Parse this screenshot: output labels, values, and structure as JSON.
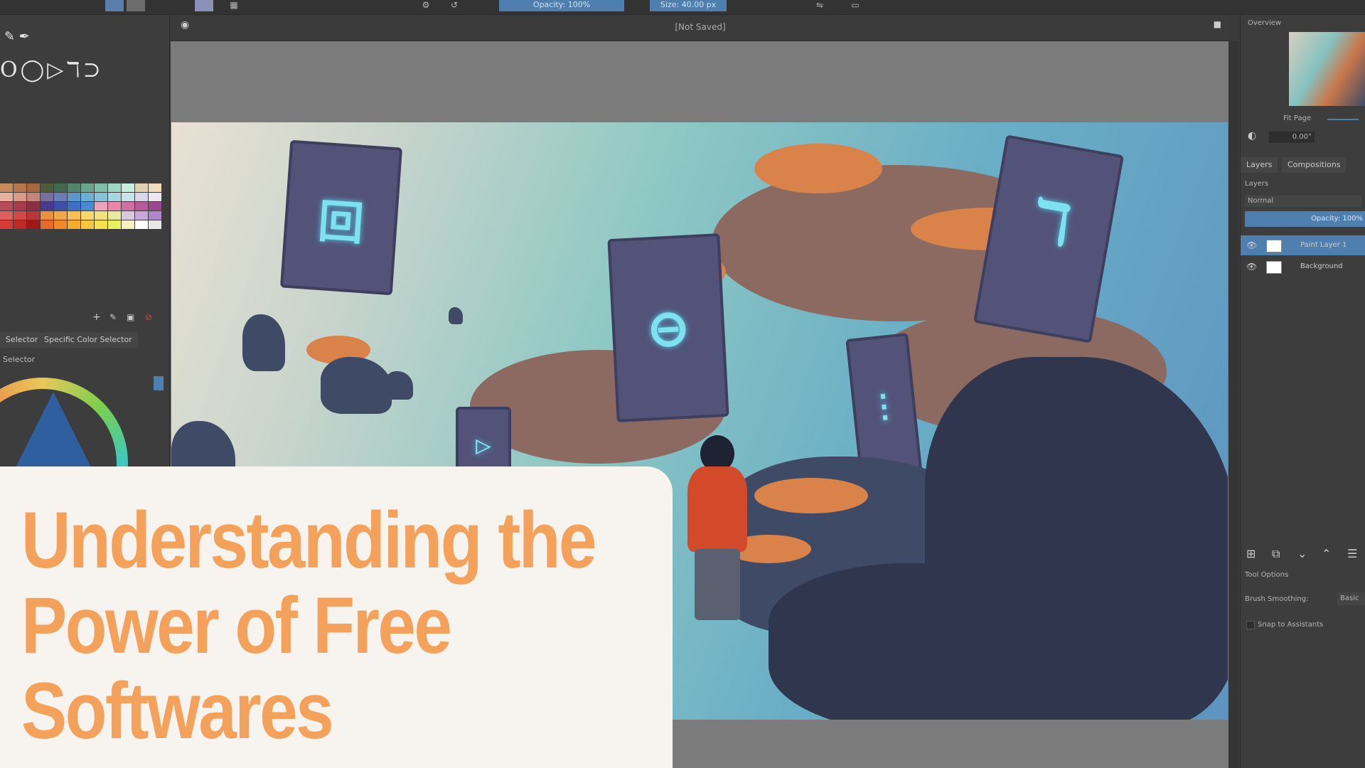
{
  "toolbar": {
    "opacity_label": "Opacity: 100%",
    "size_label": "Size: 40.00 px",
    "blend_mode": "Normal"
  },
  "canvas": {
    "title": "[Not Saved]"
  },
  "left_panel": {
    "palette_tab_a": "Selector",
    "palette_tab_b": "Specific Color Selector",
    "selector_label": "Selector",
    "palette_colors": [
      "#c78a5a",
      "#b8744c",
      "#a3683e",
      "#4f5b3c",
      "#3f6a4f",
      "#54846a",
      "#68a58a",
      "#7fbfa8",
      "#9ed6c4",
      "#c8ece0",
      "#e2d1b0",
      "#f0dcbc",
      "#e8b0a0",
      "#d99a8a",
      "#c48476",
      "#7a6f9a",
      "#6b7fb5",
      "#5d97c8",
      "#6bb0d3",
      "#86c3d8",
      "#a9d5e0",
      "#c6e4ea",
      "#d8d8e8",
      "#ece6f0",
      "#b84a5a",
      "#a63c4e",
      "#8c2f44",
      "#4a3a8a",
      "#3d4fa8",
      "#3f6fc4",
      "#4a8ad0",
      "#f0a0b8",
      "#e888a8",
      "#d070a0",
      "#b85a98",
      "#9a4a8c",
      "#e06060",
      "#d04a4a",
      "#b83838",
      "#e89040",
      "#f0a848",
      "#f8c050",
      "#f8d868",
      "#f0e080",
      "#e8e8a0",
      "#d8c8e0",
      "#c8a8d8",
      "#b088c8",
      "#d83a3a",
      "#c02828",
      "#a01818",
      "#e86a2a",
      "#f08a2a",
      "#f8aa2a",
      "#f8c83a",
      "#f8e048",
      "#e8f060",
      "#f8f0c0",
      "#ffffff",
      "#e8e8e8"
    ]
  },
  "right_panel": {
    "overview_label": "Overview",
    "fit_page_label": "Fit Page",
    "rotation_value": "0.00°",
    "tab_layers": "Layers",
    "tab_compositions": "Compositions",
    "layers_header": "Layers",
    "blend_mode": "Normal",
    "opacity_label": "Opacity: 100%",
    "layers": [
      {
        "name": "Paint Layer 1"
      },
      {
        "name": "Background"
      }
    ],
    "tool_options_label": "Tool Options",
    "brush_smoothing_label": "Brush Smoothing:",
    "brush_smoothing_value": "Basic",
    "snap_label": "Snap to Assistants"
  },
  "headline": {
    "line1": "Understanding the",
    "line2": "Power of Free",
    "line3": "Softwares"
  },
  "colors": {
    "accent": "#4f7fae",
    "headline": "#f4a15c",
    "card": "#f7f3ee"
  }
}
